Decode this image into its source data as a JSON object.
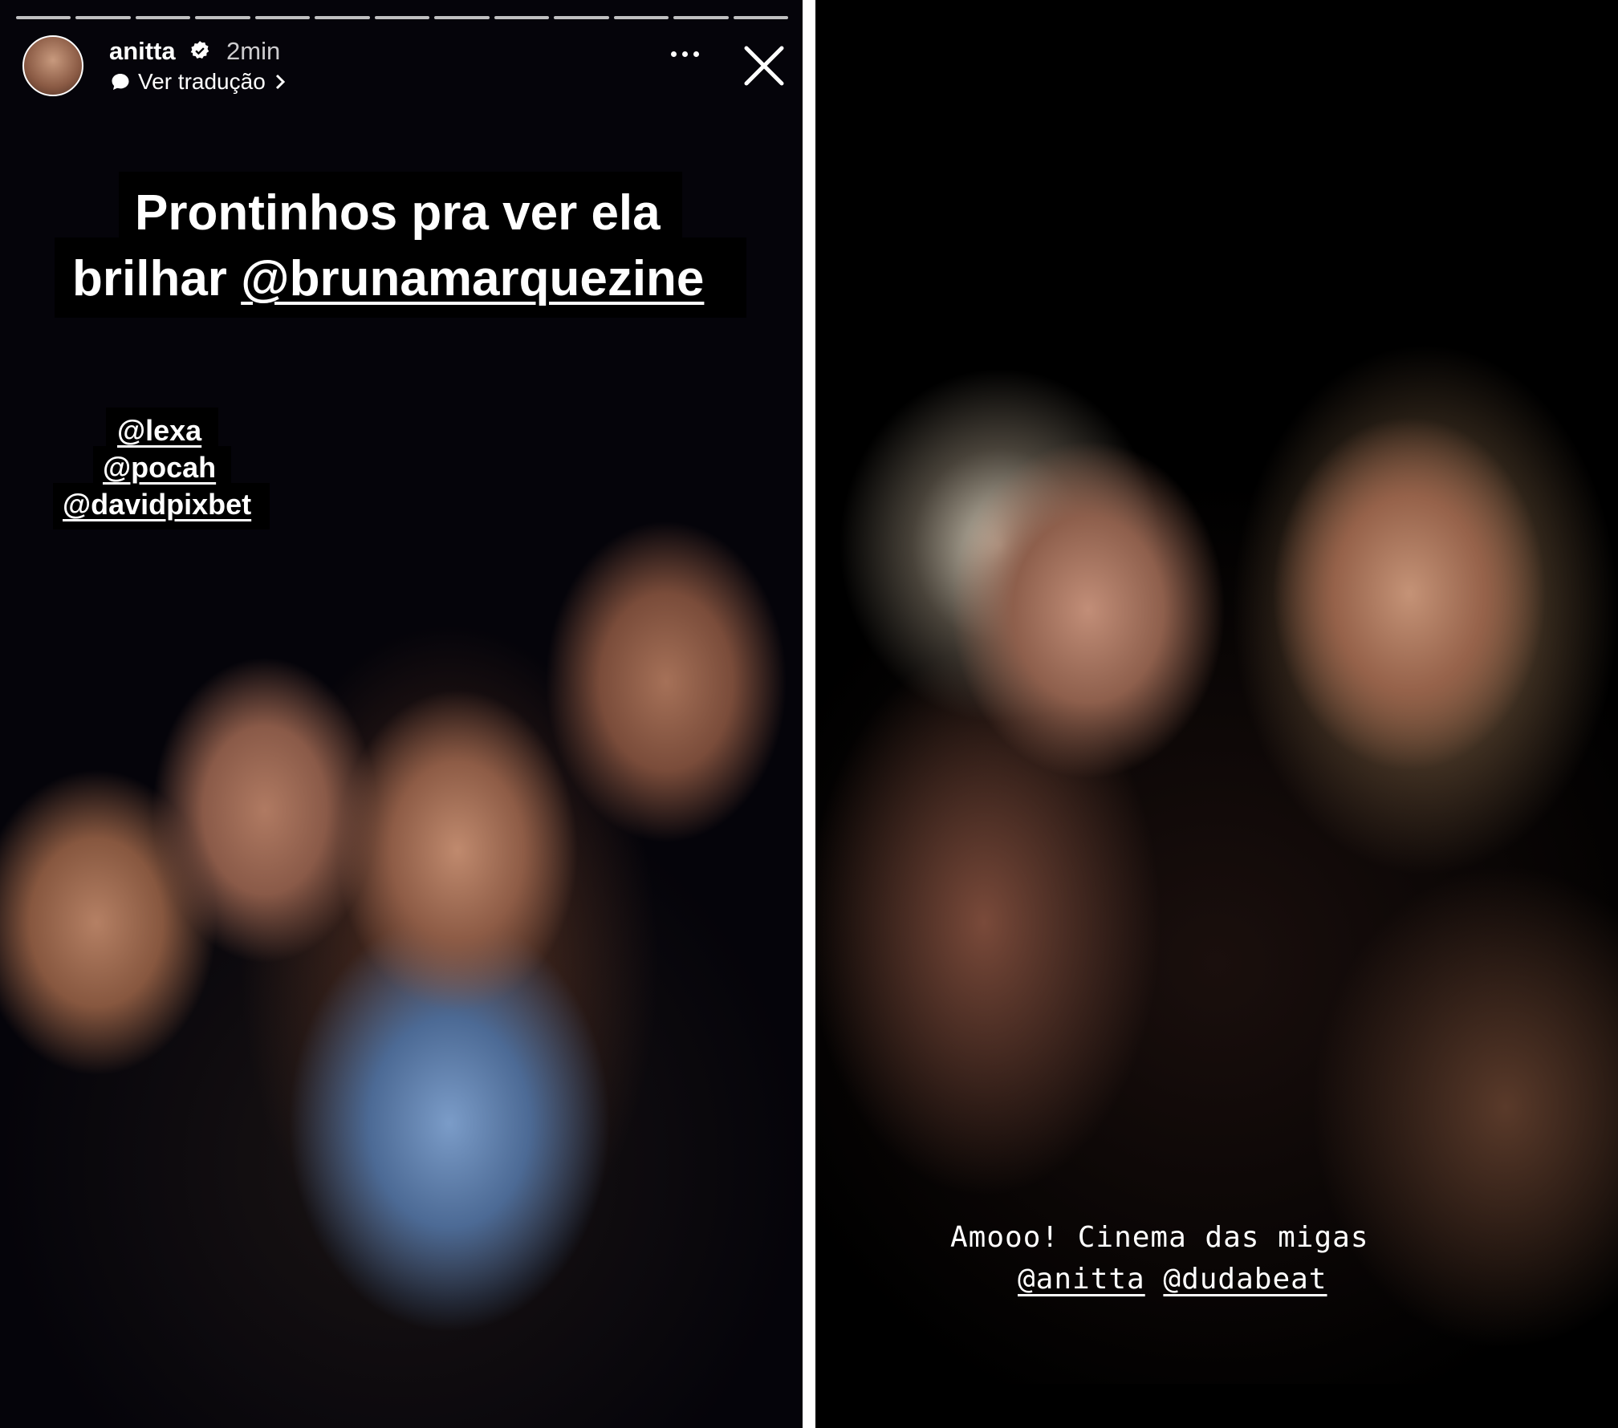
{
  "story_left": {
    "username": "anitta",
    "time": "2min",
    "translate_label": "Ver tradução",
    "caption_line1": "Prontinhos pra ver ela",
    "caption_line2_prefix": "brilhar ",
    "caption_mention": "@brunamarquezine",
    "tags": [
      "@lexa",
      "@pocah",
      "@davidpixbet"
    ],
    "progress_segments": 13
  },
  "story_right": {
    "caption_line1": "Amooo! Cinema das migas",
    "mention1": "@anitta",
    "mention2": "@dudabeat"
  },
  "icons": {
    "verified": "verified-badge-icon",
    "translate": "chat-bubble-icon",
    "chevron": "chevron-right-icon",
    "more": "more-horizontal-icon",
    "close": "close-icon"
  }
}
